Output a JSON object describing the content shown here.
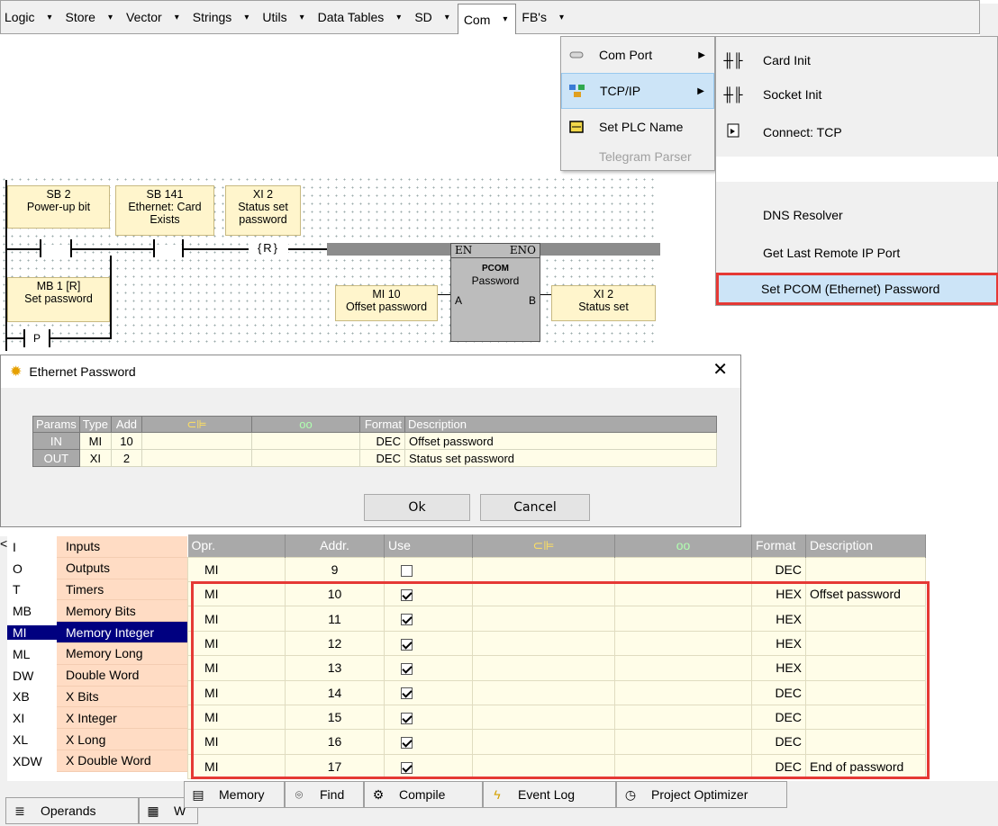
{
  "menubar": {
    "items": [
      {
        "label": "Logic",
        "arrow": "▾"
      },
      {
        "label": "Store",
        "arrow": "▾"
      },
      {
        "label": "Vector",
        "arrow": "▾"
      },
      {
        "label": "Strings",
        "arrow": "▾"
      },
      {
        "label": "Utils",
        "arrow": "▾"
      },
      {
        "label": "Data Tables",
        "arrow": "▾"
      },
      {
        "label": "SD",
        "arrow": "▾"
      },
      {
        "label": "Com",
        "arrow": "▾"
      },
      {
        "label": "FB's",
        "arrow": "▾"
      }
    ]
  },
  "com_menu": {
    "items": [
      {
        "label": "Com Port",
        "icon": "cable-icon",
        "submenu": true
      },
      {
        "label": "TCP/IP",
        "icon": "network-icon",
        "submenu": true
      },
      {
        "label": "Set PLC Name",
        "icon": "plc-name-icon",
        "submenu": false
      },
      {
        "label": "Telegram Parser",
        "icon": "",
        "submenu": false
      }
    ]
  },
  "tcpip_submenu": {
    "items": [
      {
        "label": "Card Init",
        "icon": "fb-icon"
      },
      {
        "label": "Socket Init",
        "icon": "fb-icon"
      },
      {
        "label": "Connect: TCP",
        "icon": "connect-icon"
      },
      {
        "label": "DNS Resolver",
        "icon": ""
      },
      {
        "label": "Get Last Remote IP Port",
        "icon": ""
      },
      {
        "label": "Set PCOM (Ethernet) Password",
        "icon": ""
      }
    ]
  },
  "ladder": {
    "sb2": {
      "line1": "SB 2",
      "line2": "Power-up bit"
    },
    "sb141": {
      "line1": "SB 141",
      "line2": "Ethernet: Card",
      "line3": "Exists"
    },
    "xi2_top": {
      "line1": "XI 2",
      "line2": "Status set",
      "line3": "password"
    },
    "coil_label": "{R}",
    "mb1": {
      "line1": "MB 1 [R]",
      "line2": "Set password"
    },
    "p_contact": "P",
    "mi10": {
      "line1": "MI 10",
      "line2": "Offset password"
    },
    "xi2_bottom": {
      "line1": "XI 2",
      "line2": "Status set"
    },
    "block": {
      "en": "EN",
      "eno": "ENO",
      "title": "PCOM",
      "subtitle": "Password",
      "in_a": "A",
      "out_b": "B"
    }
  },
  "dialog": {
    "title": "Ethernet Password",
    "close": "✕",
    "headers": [
      "Params",
      "Type",
      "Add",
      "",
      "",
      "Format",
      "Description"
    ],
    "rows": [
      {
        "param": "IN",
        "type": "MI",
        "add": "10",
        "format": "DEC",
        "desc": "Offset password"
      },
      {
        "param": "OUT",
        "type": "XI",
        "add": "2",
        "format": "DEC",
        "desc": "Status set password"
      }
    ],
    "ok_label": "Ok",
    "cancel_label": "Cancel"
  },
  "operands": {
    "items": [
      {
        "code": "I",
        "name": "Inputs"
      },
      {
        "code": "O",
        "name": "Outputs"
      },
      {
        "code": "T",
        "name": "Timers"
      },
      {
        "code": "MB",
        "name": "Memory Bits"
      },
      {
        "code": "MI",
        "name": "Memory Integer"
      },
      {
        "code": "ML",
        "name": "Memory Long"
      },
      {
        "code": "DW",
        "name": "Double Word"
      },
      {
        "code": "XB",
        "name": "X Bits"
      },
      {
        "code": "XI",
        "name": "X Integer"
      },
      {
        "code": "XL",
        "name": "X Long"
      },
      {
        "code": "XDW",
        "name": "X Double Word"
      }
    ],
    "selected": 4,
    "scroll_mark": "<"
  },
  "grid": {
    "headers": [
      "Opr.",
      "Addr.",
      "Use",
      "",
      "",
      "Format",
      "Description"
    ],
    "rows": [
      {
        "opr": "MI",
        "addr": "9",
        "use": false,
        "format": "DEC",
        "desc": ""
      },
      {
        "opr": "MI",
        "addr": "10",
        "use": true,
        "format": "HEX",
        "desc": "Offset password"
      },
      {
        "opr": "MI",
        "addr": "11",
        "use": true,
        "format": "HEX",
        "desc": ""
      },
      {
        "opr": "MI",
        "addr": "12",
        "use": true,
        "format": "HEX",
        "desc": ""
      },
      {
        "opr": "MI",
        "addr": "13",
        "use": true,
        "format": "HEX",
        "desc": ""
      },
      {
        "opr": "MI",
        "addr": "14",
        "use": true,
        "format": "DEC",
        "desc": ""
      },
      {
        "opr": "MI",
        "addr": "15",
        "use": true,
        "format": "DEC",
        "desc": ""
      },
      {
        "opr": "MI",
        "addr": "16",
        "use": true,
        "format": "DEC",
        "desc": ""
      },
      {
        "opr": "MI",
        "addr": "17",
        "use": true,
        "format": "DEC",
        "desc": "End of password"
      }
    ]
  },
  "bottom_tabs": [
    {
      "label": "Operands",
      "icon": "operands-icon"
    },
    {
      "label": "W",
      "icon": "watch-icon"
    },
    {
      "label": "Memory",
      "icon": "memory-icon"
    },
    {
      "label": "Find",
      "icon": "binoculars-icon"
    },
    {
      "label": "Compile",
      "icon": "compile-icon"
    },
    {
      "label": "Event Log",
      "icon": "lightning-icon"
    },
    {
      "label": "Project Optimizer",
      "icon": "optimizer-icon"
    }
  ],
  "colors": {
    "highlight": "#e53935",
    "selected_operand": "#000080",
    "table_header": "#a9a9a9",
    "cell_bg": "#fffde8",
    "operand_bg": "#ffdcc4",
    "ladder_box": "#fff5cc"
  }
}
